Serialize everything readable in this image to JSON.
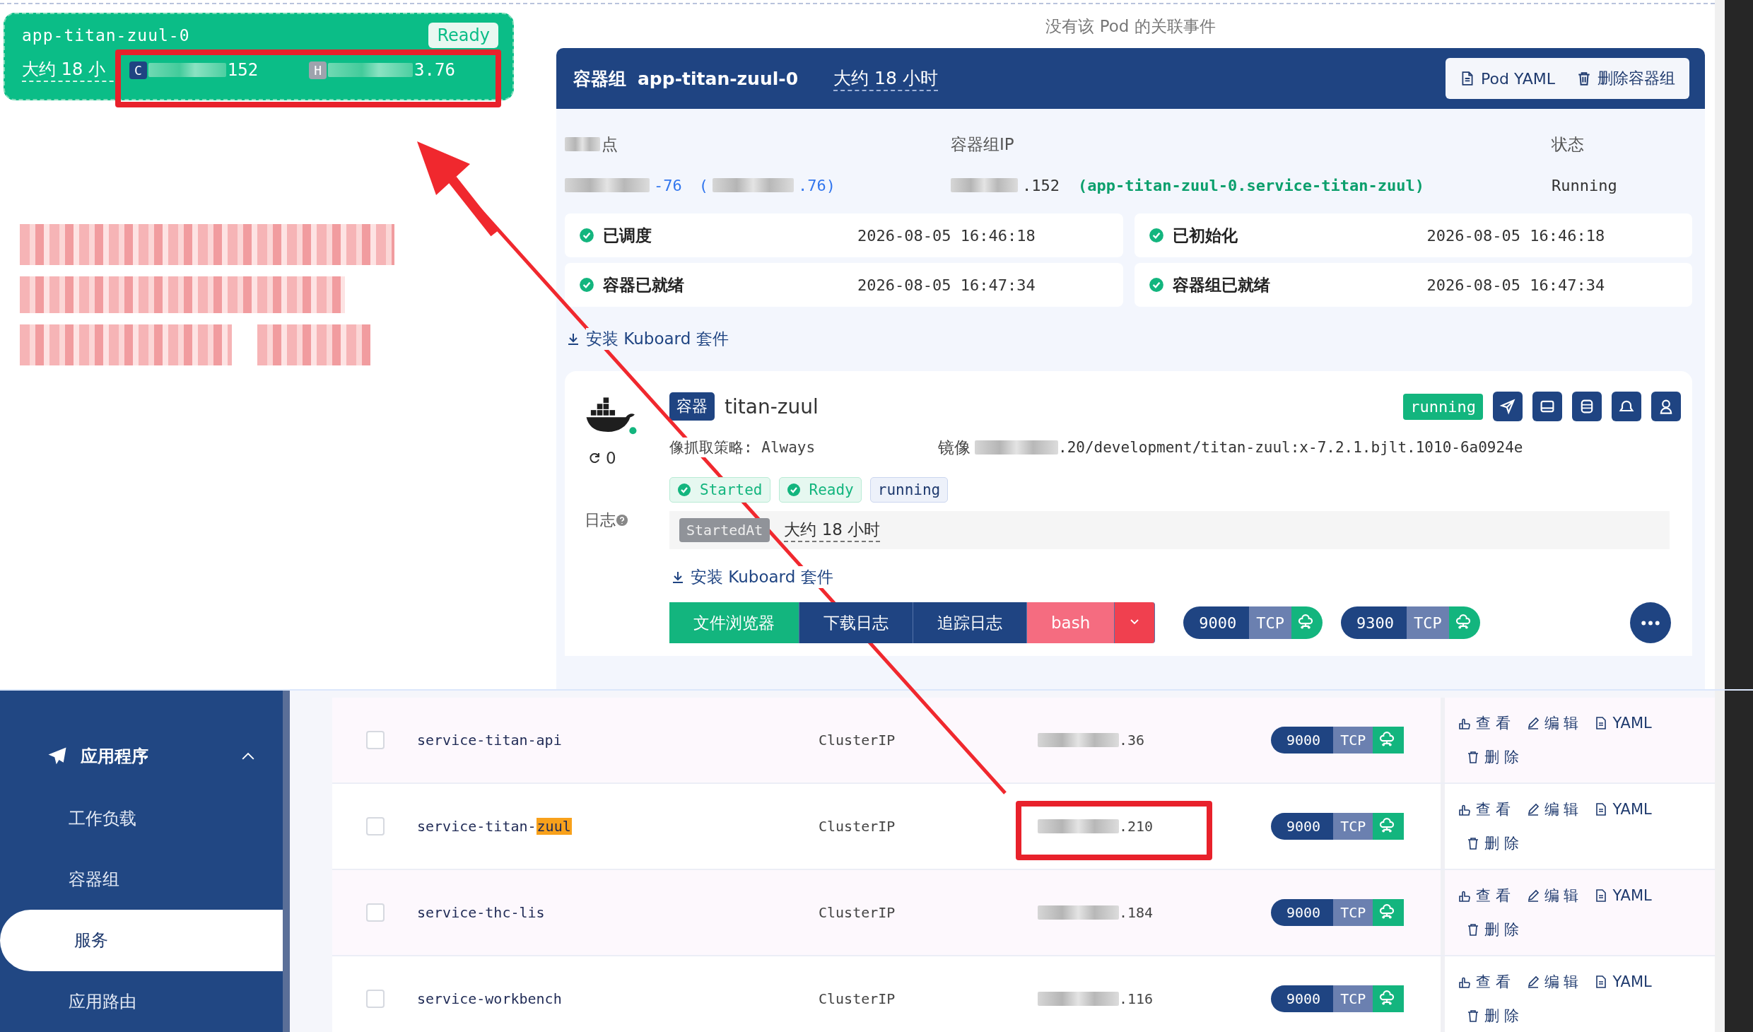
{
  "tooltip": {
    "title": "app-titan-zuul-0",
    "status": "Ready",
    "age": "大约 18 小",
    "container_badge": "C",
    "container_ip": "152",
    "host_badge": "H",
    "host_ip": "3.76"
  },
  "events_message": "没有该 Pod 的关联事件",
  "pod": {
    "kind_label": "容器组",
    "name": "app-titan-zuul-0",
    "age": "大约 18 小时",
    "buttons": [
      {
        "label": "Pod YAML",
        "kind": "file"
      },
      {
        "label": "删除容器组",
        "kind": "trash"
      }
    ],
    "node": {
      "label": "点",
      "name_tail": "-76",
      "ip_open": "(",
      "ip_tail": ".76)"
    },
    "pod_ip": {
      "label": "容器组IP",
      "value_tail": ".152",
      "dns": "(app-titan-zuul-0.service-titan-zuul)"
    },
    "status": {
      "label": "状态",
      "value": "Running"
    },
    "conditions": [
      {
        "label": "已调度",
        "time": "2026-08-05 16:46:18",
        "ok": true
      },
      {
        "label": "已初始化",
        "time": "2026-08-05 16:46:18",
        "ok": true
      },
      {
        "label": "容器已就绪",
        "time": "2026-08-05 16:47:34",
        "ok": true
      },
      {
        "label": "容器组已就绪",
        "time": "2026-08-05 16:47:34",
        "ok": true
      }
    ],
    "install_link": "安装 Kuboard 套件"
  },
  "container": {
    "kind_label": "容器",
    "name": "titan-zuul",
    "state": "running",
    "restarts": "0",
    "logs_label": "日志",
    "tools": [
      {
        "kind": "send"
      },
      {
        "kind": "window"
      },
      {
        "kind": "database"
      },
      {
        "kind": "bell"
      },
      {
        "kind": "user"
      }
    ],
    "pull_policy": "像抓取策略: Always",
    "image_label": "镜像",
    "image_tail": ".20/development/titan-zuul:x-7.2.1.bjlt.1010-6a0924e",
    "tags": [
      {
        "label": "Started",
        "kind": "ok"
      },
      {
        "label": "Ready",
        "kind": "ok"
      },
      {
        "label": "running",
        "kind": "plain"
      }
    ],
    "started_label": "StartedAt",
    "started_value": "大约 18 小时",
    "install_link": "安装 Kuboard 套件",
    "actions": [
      {
        "label": "文件浏览器",
        "kind": "green"
      },
      {
        "label": "下载日志",
        "kind": "blue"
      },
      {
        "label": "追踪日志",
        "kind": "blue"
      },
      {
        "label": "bash",
        "kind": "pink"
      }
    ],
    "ports": [
      {
        "port": "9000",
        "protocol": "TCP"
      },
      {
        "port": "9300",
        "protocol": "TCP"
      }
    ]
  },
  "sidebar": {
    "items": [
      {
        "label": "应用程序",
        "kind": "group",
        "expanded": true
      },
      {
        "label": "工作负载",
        "kind": "sub",
        "selected": false
      },
      {
        "label": "容器组",
        "kind": "sub",
        "selected": false
      },
      {
        "label": "服务",
        "kind": "sub",
        "selected": true
      },
      {
        "label": "应用路由",
        "kind": "sub",
        "selected": false
      }
    ]
  },
  "services": [
    {
      "name": "service-titan-api",
      "type": "ClusterIP",
      "ip_tail": ".36",
      "checked": false,
      "ports": [
        {
          "port": "9000",
          "protocol": "TCP"
        }
      ],
      "actions": [
        {
          "label": "查 看",
          "kind": "view"
        },
        {
          "label": "编 辑",
          "kind": "edit"
        },
        {
          "label": "YAML",
          "kind": "yaml"
        },
        {
          "label": "删 除",
          "kind": "delete"
        }
      ]
    },
    {
      "name": "service-titan-",
      "match": "zuul",
      "type": "ClusterIP",
      "ip_tail": ".210",
      "checked": false,
      "ports": [
        {
          "port": "9000",
          "protocol": "TCP"
        }
      ],
      "actions": [
        {
          "label": "查 看",
          "kind": "view"
        },
        {
          "label": "编 辑",
          "kind": "edit"
        },
        {
          "label": "YAML",
          "kind": "yaml"
        },
        {
          "label": "删 除",
          "kind": "delete"
        }
      ]
    },
    {
      "name": "service-thc-lis",
      "type": "ClusterIP",
      "ip_tail": ".184",
      "checked": false,
      "ports": [
        {
          "port": "9000",
          "protocol": "TCP"
        }
      ],
      "actions": [
        {
          "label": "查 看",
          "kind": "view"
        },
        {
          "label": "编 辑",
          "kind": "edit"
        },
        {
          "label": "YAML",
          "kind": "yaml"
        },
        {
          "label": "删 除",
          "kind": "delete"
        }
      ]
    },
    {
      "name": "service-workbench",
      "type": "ClusterIP",
      "ip_tail": ".116",
      "checked": false,
      "ports": [
        {
          "port": "9000",
          "protocol": "TCP"
        }
      ],
      "actions": [
        {
          "label": "查 看",
          "kind": "view"
        },
        {
          "label": "编 辑",
          "kind": "edit"
        },
        {
          "label": "YAML",
          "kind": "yaml"
        },
        {
          "label": "删 除",
          "kind": "delete"
        }
      ]
    }
  ]
}
